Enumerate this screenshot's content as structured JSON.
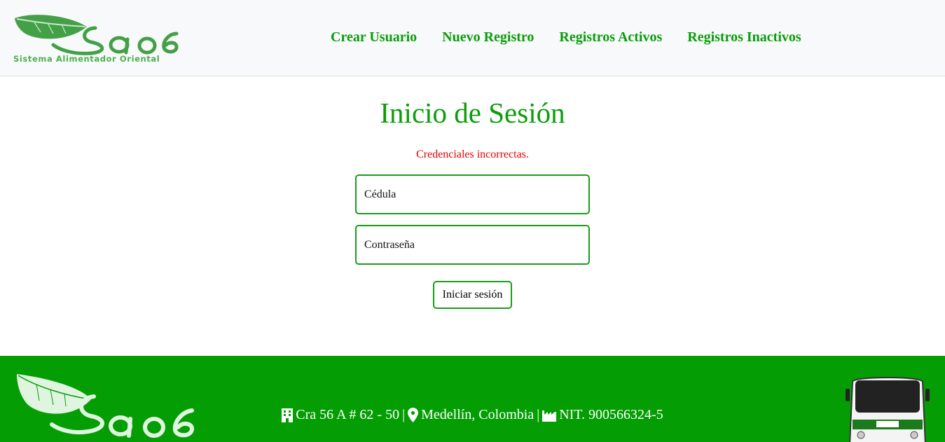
{
  "brand": {
    "logo_text": "Sao 6",
    "tagline": "Sistema Alimentador Oriental"
  },
  "nav": {
    "items": [
      {
        "label": "Crear Usuario"
      },
      {
        "label": "Nuevo Registro"
      },
      {
        "label": "Registros Activos"
      },
      {
        "label": "Registros Inactivos"
      }
    ]
  },
  "login": {
    "title": "Inicio de Sesión",
    "error": "Credenciales incorrectas.",
    "cedula_placeholder": "Cédula",
    "password_placeholder": "Contraseña",
    "submit_label": "Iniciar sesión"
  },
  "footer": {
    "address": "Cra 56 A # 62 - 50",
    "separator": "|",
    "city": "Medellín, Colombia",
    "nit": "NIT. 900566324-5"
  },
  "colors": {
    "brand_green": "#0a9d0a",
    "footer_green": "#049e04",
    "error_red": "#e60000"
  },
  "icons": [
    "building-icon",
    "map-marker-icon",
    "industry-icon",
    "leaf-icon",
    "bus-icon"
  ]
}
